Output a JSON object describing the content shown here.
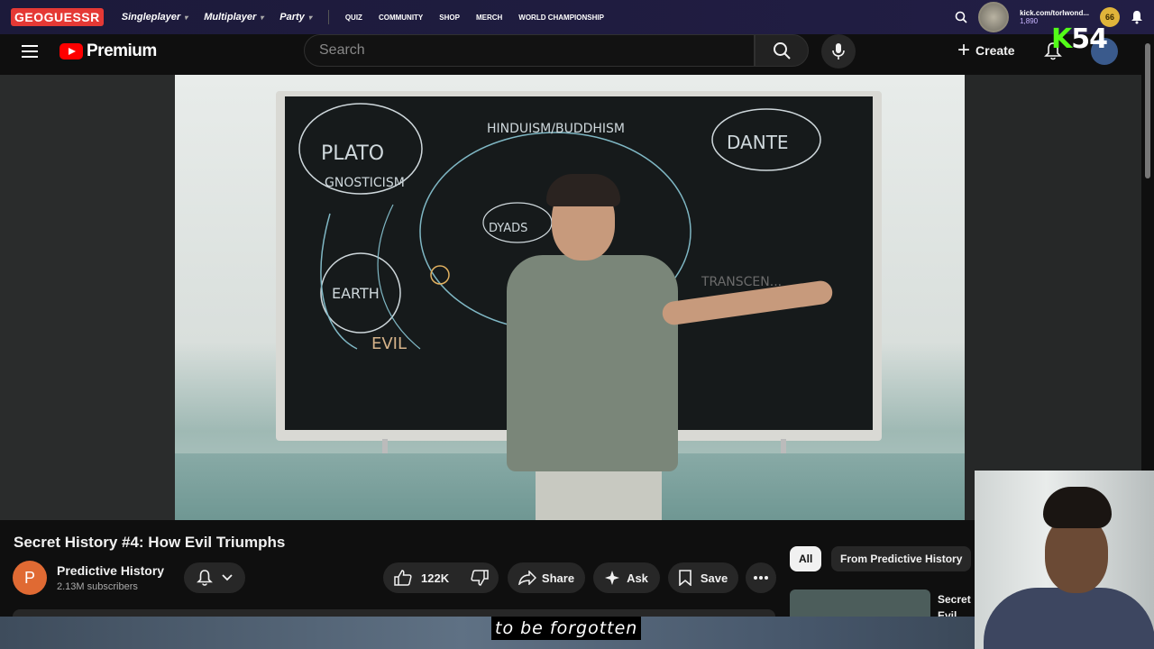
{
  "geoguessr": {
    "logo": "GEOGUESSR",
    "nav": [
      "Singleplayer",
      "Multiplayer",
      "Party"
    ],
    "links": [
      "QUIZ",
      "COMMUNITY",
      "SHOP",
      "MERCH",
      "WORLD CHAMPIONSHIP"
    ],
    "username": "kick.com/torlwond...",
    "coins": "1,890",
    "level": "66"
  },
  "overlay": {
    "kick_letter": "K",
    "kick_count": "54"
  },
  "youtube": {
    "logo_text": "Premium",
    "search_placeholder": "Search",
    "create_label": "Create"
  },
  "video": {
    "title": "Secret History #4: How Evil Triumphs",
    "channel_initial": "P",
    "channel_name": "Predictive History",
    "subscribers": "2.13M subscribers",
    "likes": "122K",
    "share_label": "Share",
    "ask_label": "Ask",
    "save_label": "Save",
    "caption": "to be forgotten",
    "board_words": [
      "PLATO",
      "GNOSTICISM",
      "HINDUISM/BUDDHISM",
      "DANTE",
      "EARTH",
      "EVIL",
      "DYADS",
      "TRANSCEN..."
    ]
  },
  "recommendations": {
    "chips": [
      "All",
      "From Predictive History"
    ],
    "first_title": "Secret Evil"
  }
}
